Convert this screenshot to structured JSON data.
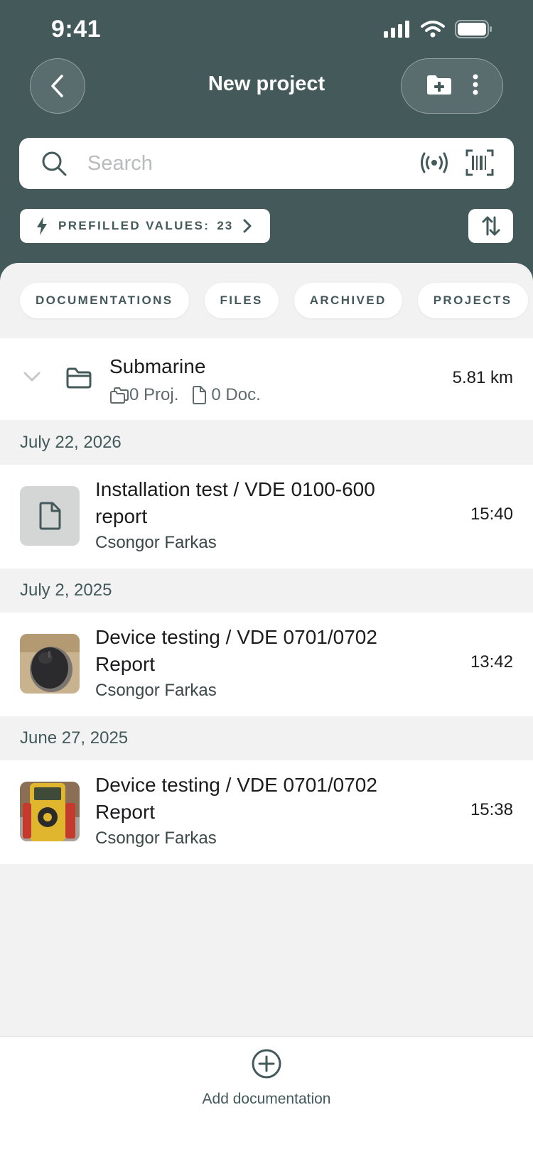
{
  "status_bar": {
    "time": "9:41"
  },
  "nav": {
    "title": "New project"
  },
  "search": {
    "placeholder": "Search",
    "value": ""
  },
  "prefilled": {
    "label": "PREFILLED VALUES:",
    "count": "23"
  },
  "tabs": [
    {
      "label": "DOCUMENTATIONS"
    },
    {
      "label": "FILES"
    },
    {
      "label": "ARCHIVED"
    },
    {
      "label": "PROJECTS"
    }
  ],
  "folder": {
    "name": "Submarine",
    "projects": "0 Proj.",
    "documents": "0 Doc.",
    "distance": "5.81 km"
  },
  "groups": [
    {
      "date": "July 22, 2026",
      "items": [
        {
          "title": "Installation test / VDE 0100-600 report",
          "author": "Csongor Farkas",
          "time": "15:40",
          "thumb": "file-icon"
        }
      ]
    },
    {
      "date": "July 2, 2025",
      "items": [
        {
          "title": "Device testing / VDE 0701/0702 Report",
          "author": "Csongor Farkas",
          "time": "13:42",
          "thumb": "photo-mouse"
        }
      ]
    },
    {
      "date": "June 27, 2025",
      "items": [
        {
          "title": "Device testing / VDE 0701/0702 Report",
          "author": "Csongor Farkas",
          "time": "15:38",
          "thumb": "photo-multimeter"
        }
      ]
    }
  ],
  "bottom": {
    "add_label": "Add documentation"
  },
  "colors": {
    "header": "#43595a",
    "background": "#f2f2f2",
    "accent_text": "#43595a"
  }
}
